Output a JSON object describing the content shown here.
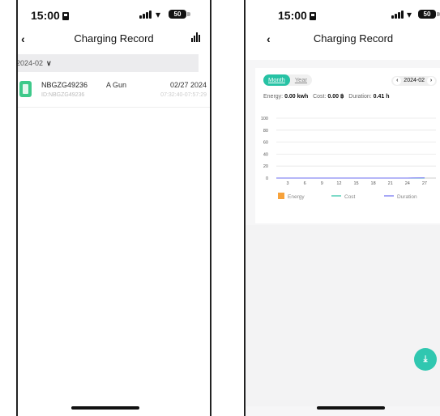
{
  "status": {
    "time": "15:00",
    "battery": "50"
  },
  "left": {
    "title": "Charging Record",
    "month_filter": "2024-02",
    "records": [
      {
        "name": "NBGZG49236",
        "id": "ID:NBGZG49236",
        "gun": "A Gun",
        "date": "02/27 2024",
        "span": "07:32:40-07:57:29"
      }
    ]
  },
  "right": {
    "title": "Charging Record",
    "tabs": {
      "month": "Month",
      "year": "Year",
      "active": "Month"
    },
    "month": "2024-02",
    "stats": {
      "energy_label": "Energy:",
      "energy": "0.00 kwh",
      "cost_label": "Cost:",
      "cost": "0.00 ฿",
      "duration_label": "Duration:",
      "duration": "0.41 h"
    },
    "fab_icon": "download-icon"
  },
  "chart_data": {
    "type": "line",
    "x": [
      3,
      6,
      9,
      12,
      15,
      18,
      21,
      24,
      27
    ],
    "ylim": [
      0,
      100
    ],
    "yticks": [
      0,
      20,
      40,
      60,
      80,
      100
    ],
    "legend_position": "bottom",
    "series": [
      {
        "name": "Energy",
        "kind": "bar",
        "color": "#f7a23b",
        "values": [
          0,
          0,
          0,
          0,
          0,
          0,
          0,
          0,
          0
        ]
      },
      {
        "name": "Cost",
        "kind": "line",
        "color": "#26c2a4",
        "values": [
          0,
          0,
          0,
          0,
          0,
          0,
          0,
          0,
          0
        ]
      },
      {
        "name": "Duration",
        "kind": "line",
        "color": "#6b6cf0",
        "values": [
          0,
          0,
          0,
          0,
          0,
          0,
          0,
          0,
          0.41
        ]
      }
    ]
  }
}
